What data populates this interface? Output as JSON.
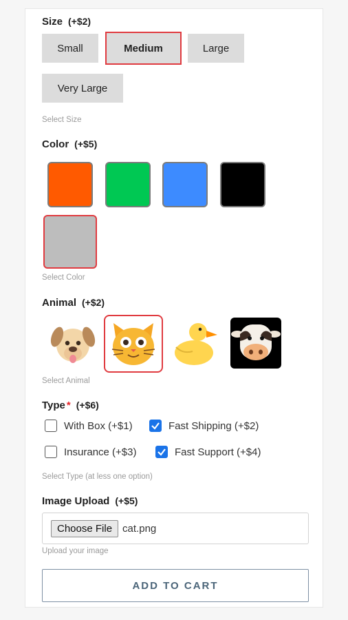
{
  "size": {
    "label": "Size",
    "price": "(+$2)",
    "options": [
      "Small",
      "Medium",
      "Large",
      "Very Large"
    ],
    "selected": "Medium",
    "helper": "Select Size"
  },
  "color": {
    "label": "Color",
    "price": "(+$5)",
    "swatches": [
      "#ff5a00",
      "#00c853",
      "#3d8bff",
      "#000000",
      "#bdbdbd"
    ],
    "selected_color": "#bdbdbd",
    "helper": "Select Color"
  },
  "animal": {
    "label": "Animal",
    "price": "(+$2)",
    "options": [
      "dog-icon",
      "cat-icon",
      "duck-icon",
      "cow-icon"
    ],
    "selected": "cat-icon",
    "helper": "Select Animal"
  },
  "type": {
    "label": "Type",
    "required_mark": "*",
    "price": "(+$6)",
    "options": [
      {
        "label": "With Box (+$1)",
        "checked": false
      },
      {
        "label": "Fast Shipping (+$2)",
        "checked": true
      },
      {
        "label": "Insurance (+$3)",
        "checked": false
      },
      {
        "label": "Fast Support (+$4)",
        "checked": true
      }
    ],
    "helper": "Select Type (at less one option)"
  },
  "upload": {
    "label": "Image Upload",
    "price": "(+$5)",
    "button": "Choose File",
    "file_name": "cat.png",
    "helper": "Upload your image"
  },
  "cart": {
    "button": "ADD TO CART"
  },
  "colors": {
    "selected_border": "#e03a3f",
    "checkbox_blue": "#1a73e8",
    "cart_text": "#4b6579"
  }
}
